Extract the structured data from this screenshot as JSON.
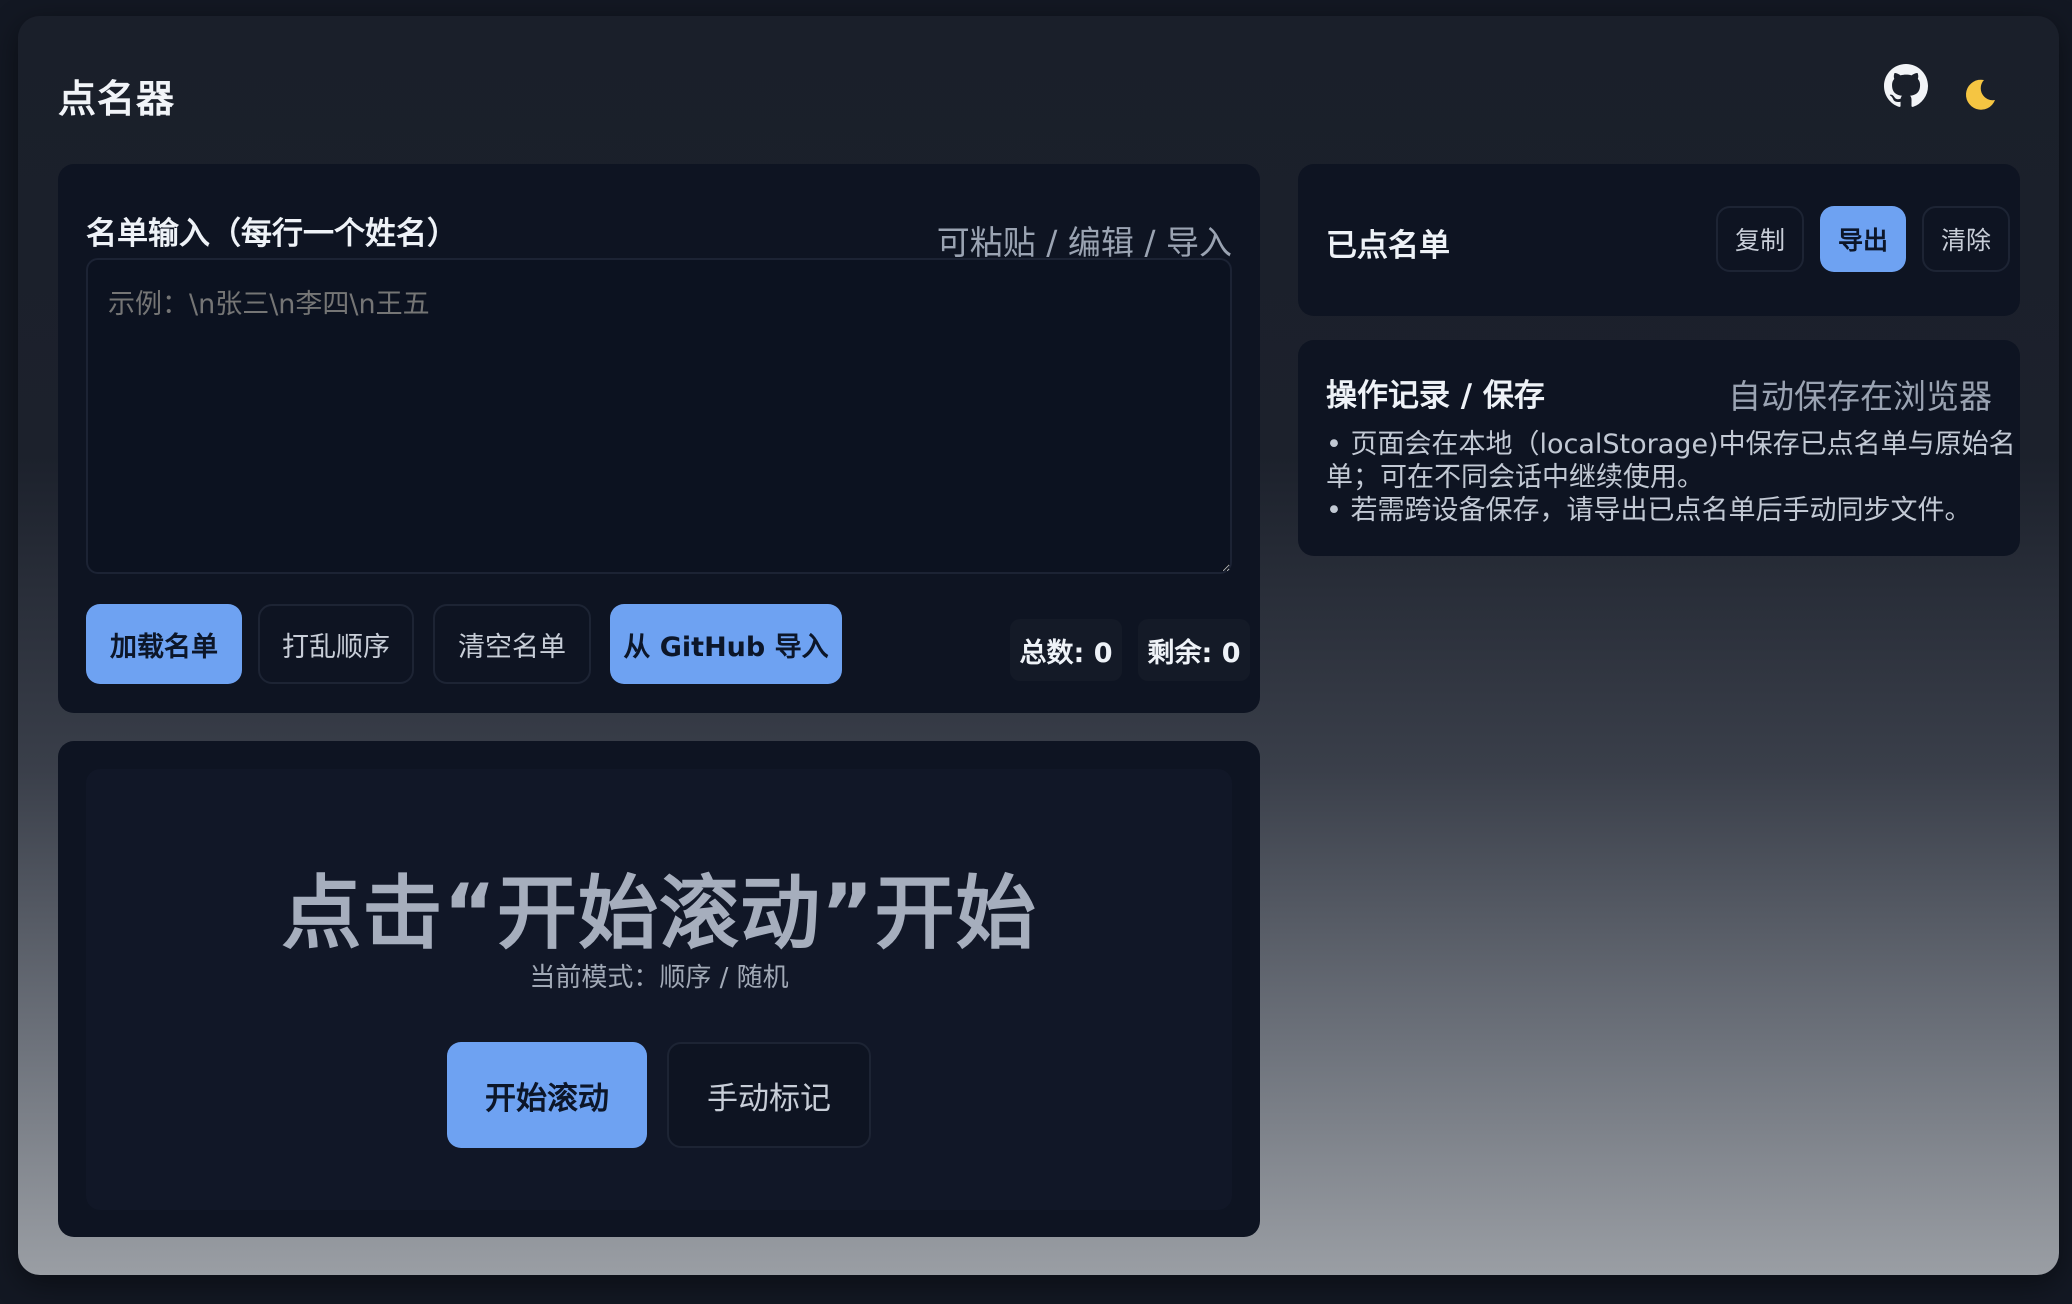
{
  "app": {
    "title": "点名器"
  },
  "roster": {
    "title": "名单输入（每行一个姓名）",
    "hint": "可粘贴 / 编辑 / 导入",
    "placeholder": "示例：\\n张三\\n李四\\n王五",
    "buttons": {
      "load": "加载名单",
      "shuffle": "打乱顺序",
      "clear": "清空名单",
      "github_import": "从 GitHub 导入"
    },
    "total_label": "总数: 0",
    "remaining_label": "剩余: 0"
  },
  "called": {
    "title": "已点名单",
    "buttons": {
      "copy": "复制",
      "export": "导出",
      "clear": "清除"
    }
  },
  "log": {
    "title": "操作记录 / 保存",
    "hint": "自动保存在浏览器",
    "lines": [
      "• 页面会在本地（localStorage)中保存已点名单与原始名",
      "单；可在不同会话中继续使用。",
      "• 若需跨设备保存，请导出已点名单后手动同步文件。"
    ]
  },
  "stage": {
    "display": "点击“开始滚动”开始",
    "mode": "当前模式：顺序 / 随机",
    "buttons": {
      "start": "开始滚动",
      "manual": "手动标记"
    }
  },
  "colors": {
    "accent": "#6ea2f2",
    "card": "#0e1422",
    "moon": "#f5c542"
  },
  "icons": {
    "github": "github-icon",
    "theme": "moon-icon"
  }
}
